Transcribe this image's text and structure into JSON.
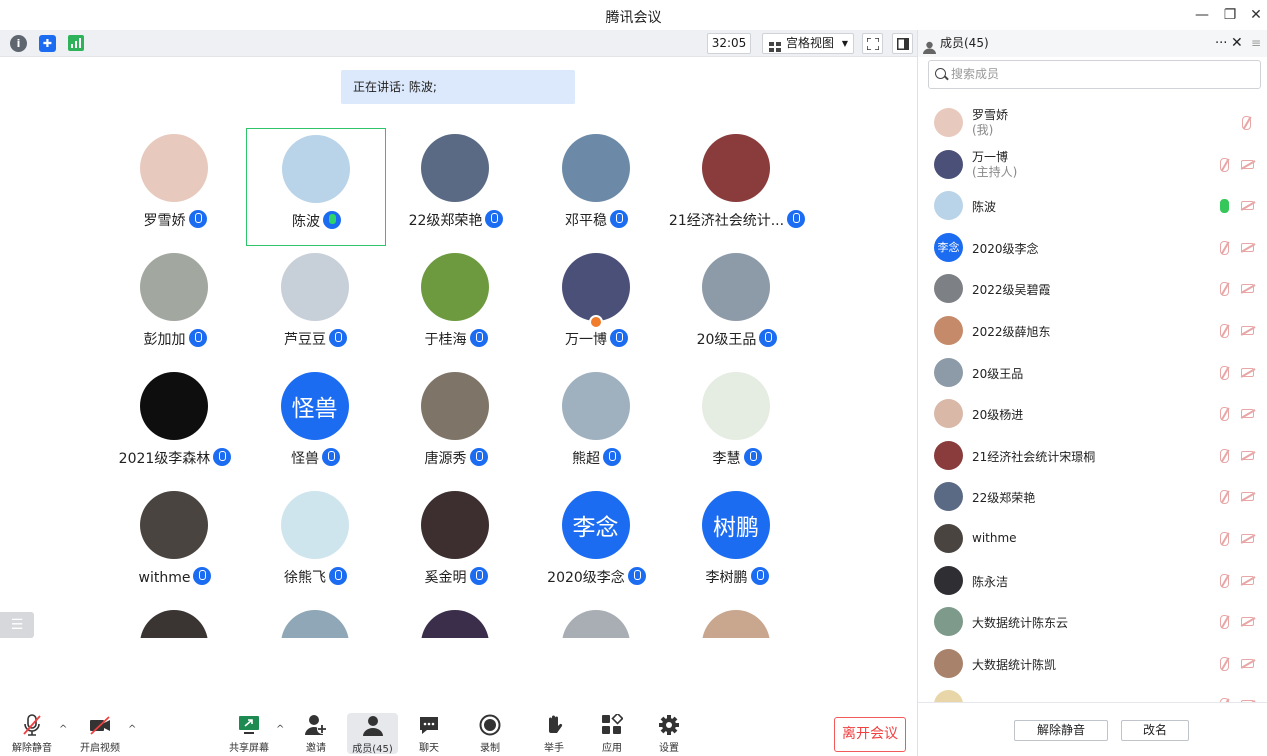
{
  "window": {
    "title": "腾讯会议",
    "min": "—",
    "max": "❐",
    "close": "✕"
  },
  "toolbar": {
    "timer": "32:05",
    "view_label": "宫格视图"
  },
  "speaking": {
    "text": "正在讲话: 陈波;"
  },
  "grid": [
    {
      "name": "罗雪娇",
      "avatar_color": "#e8c9bd",
      "avatar_text": ""
    },
    {
      "name": "陈波",
      "avatar_color": "#b9d3e8",
      "avatar_text": "",
      "active": true
    },
    {
      "name": "22级郑荣艳",
      "avatar_color": "#5b6a84",
      "avatar_text": ""
    },
    {
      "name": "邓平稳",
      "avatar_color": "#6c8aa8",
      "avatar_text": ""
    },
    {
      "name": "21经济社会统计...",
      "avatar_color": "#8a3b3b",
      "avatar_text": ""
    },
    {
      "name": "彭加加",
      "avatar_color": "#a2a7a0",
      "avatar_text": ""
    },
    {
      "name": "芦豆豆",
      "avatar_color": "#c7cfd9",
      "avatar_text": ""
    },
    {
      "name": "于桂海",
      "avatar_color": "#6d9a3f",
      "avatar_text": ""
    },
    {
      "name": "万一博",
      "avatar_color": "#4a5078",
      "avatar_text": "",
      "host": true
    },
    {
      "name": "20级王品",
      "avatar_color": "#8d9aa8",
      "avatar_text": ""
    },
    {
      "name": "2021级李森林",
      "avatar_color": "#0e0e0e",
      "avatar_text": ""
    },
    {
      "name": "怪兽",
      "avatar_color": "#1c6cf2",
      "avatar_text": "怪兽"
    },
    {
      "name": "唐源秀",
      "avatar_color": "#7f7468",
      "avatar_text": ""
    },
    {
      "name": "熊超",
      "avatar_color": "#9fb0bf",
      "avatar_text": ""
    },
    {
      "name": "李慧",
      "avatar_color": "#e5ece2",
      "avatar_text": ""
    },
    {
      "name": "withme",
      "avatar_color": "#4a4440",
      "avatar_text": ""
    },
    {
      "name": "徐熊飞",
      "avatar_color": "#cfe5ee",
      "avatar_text": ""
    },
    {
      "name": "奚金明",
      "avatar_color": "#3d2e30",
      "avatar_text": ""
    },
    {
      "name": "2020级李念",
      "avatar_color": "#1c6cf2",
      "avatar_text": "李念"
    },
    {
      "name": "李树鹏",
      "avatar_color": "#1c6cf2",
      "avatar_text": "树鹏"
    },
    {
      "name": "",
      "avatar_color": "#3a3432",
      "avatar_text": ""
    },
    {
      "name": "",
      "avatar_color": "#8fa7b6",
      "avatar_text": ""
    },
    {
      "name": "",
      "avatar_color": "#3b2e4a",
      "avatar_text": ""
    },
    {
      "name": "",
      "avatar_color": "#a8aeb4",
      "avatar_text": ""
    },
    {
      "name": "",
      "avatar_color": "#c9a78f",
      "avatar_text": ""
    }
  ],
  "bottombar": {
    "unmute": "解除静音",
    "video": "开启视频",
    "share": "共享屏幕",
    "invite": "邀请",
    "members": "成员(45)",
    "chat": "聊天",
    "record": "录制",
    "hand": "举手",
    "apps": "应用",
    "settings": "设置",
    "leave": "离开会议"
  },
  "panel": {
    "title": "成员(45)",
    "search_placeholder": "搜索成员",
    "more": "···",
    "close": "✕",
    "members": [
      {
        "name": "罗雪娇",
        "sub": "(我)",
        "color": "#e8c9bd",
        "text": "",
        "mic": "me"
      },
      {
        "name": "万一博",
        "sub": "(主持人)",
        "color": "#4a5078",
        "text": "",
        "mic": "off"
      },
      {
        "name": "陈波",
        "sub": "",
        "color": "#b9d3e8",
        "text": "",
        "mic": "on"
      },
      {
        "name": "2020级李念",
        "sub": "",
        "color": "#1c6cf2",
        "text": "李念",
        "mic": "off"
      },
      {
        "name": "2022级吴碧霞",
        "sub": "",
        "color": "#7d8084",
        "text": "",
        "mic": "off"
      },
      {
        "name": "2022级薛旭东",
        "sub": "",
        "color": "#c58a6a",
        "text": "",
        "mic": "off"
      },
      {
        "name": "20级王品",
        "sub": "",
        "color": "#8d9aa8",
        "text": "",
        "mic": "off"
      },
      {
        "name": "20级杨进",
        "sub": "",
        "color": "#d9b8a8",
        "text": "",
        "mic": "off"
      },
      {
        "name": "21经济社会统计宋璟桐",
        "sub": "",
        "color": "#8a3b3b",
        "text": "",
        "mic": "off"
      },
      {
        "name": "22级郑荣艳",
        "sub": "",
        "color": "#5b6a84",
        "text": "",
        "mic": "off"
      },
      {
        "name": "withme",
        "sub": "",
        "color": "#4a4440",
        "text": "",
        "mic": "off"
      },
      {
        "name": "陈永洁",
        "sub": "",
        "color": "#2f2f33",
        "text": "",
        "mic": "off"
      },
      {
        "name": "大数据统计陈东云",
        "sub": "",
        "color": "#7e9a8a",
        "text": "",
        "mic": "off"
      },
      {
        "name": "大数据统计陈凯",
        "sub": "",
        "color": "#a8826a",
        "text": "",
        "mic": "off"
      },
      {
        "name": "",
        "sub": "",
        "color": "#e9d6a8",
        "text": "",
        "mic": "off"
      }
    ],
    "unmute_all": "解除静音",
    "rename": "改名"
  }
}
